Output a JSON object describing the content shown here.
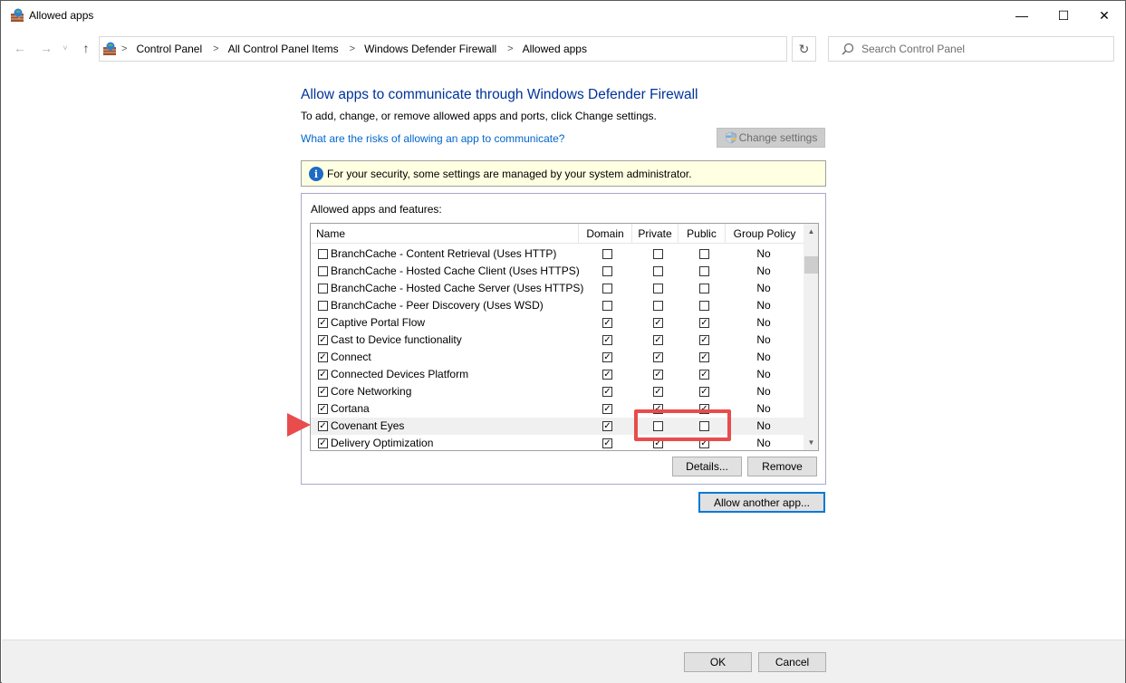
{
  "window": {
    "title": "Allowed apps",
    "minimize_glyph": "—",
    "maximize_glyph": "☐",
    "close_glyph": "✕"
  },
  "nav": {
    "back_glyph": "←",
    "forward_glyph": "→",
    "recent_glyph": "˅",
    "up_glyph": "↑",
    "breadcrumbs": [
      "Control Panel",
      "All Control Panel Items",
      "Windows Defender Firewall",
      "Allowed apps"
    ],
    "separator": ">",
    "dropdown_glyph": "⌄",
    "refresh_glyph": "↻",
    "search_placeholder": "Search Control Panel"
  },
  "main": {
    "heading": "Allow apps to communicate through Windows Defender Firewall",
    "subtext": "To add, change, or remove allowed apps and ports, click Change settings.",
    "risk_link": "What are the risks of allowing an app to communicate?",
    "change_settings": "Change settings",
    "info_icon": "i",
    "info_text": "For your security, some settings are managed by your system administrator.",
    "group_label": "Allowed apps and features:",
    "columns": [
      "Name",
      "Domain",
      "Private",
      "Public",
      "Group Policy"
    ],
    "rows": [
      {
        "name": "BranchCache - Content Retrieval (Uses HTTP)",
        "enabled": "",
        "domain": "",
        "private": "",
        "public": "",
        "gp": "No"
      },
      {
        "name": "BranchCache - Hosted Cache Client (Uses HTTPS)",
        "enabled": "",
        "domain": "",
        "private": "",
        "public": "",
        "gp": "No"
      },
      {
        "name": "BranchCache - Hosted Cache Server (Uses HTTPS)",
        "enabled": "",
        "domain": "",
        "private": "",
        "public": "",
        "gp": "No"
      },
      {
        "name": "BranchCache - Peer Discovery (Uses WSD)",
        "enabled": "",
        "domain": "",
        "private": "",
        "public": "",
        "gp": "No"
      },
      {
        "name": "Captive Portal Flow",
        "enabled": "✓",
        "domain": "✓",
        "private": "✓",
        "public": "✓",
        "gp": "No"
      },
      {
        "name": "Cast to Device functionality",
        "enabled": "✓",
        "domain": "✓",
        "private": "✓",
        "public": "✓",
        "gp": "No"
      },
      {
        "name": "Connect",
        "enabled": "✓",
        "domain": "✓",
        "private": "✓",
        "public": "✓",
        "gp": "No"
      },
      {
        "name": "Connected Devices Platform",
        "enabled": "✓",
        "domain": "✓",
        "private": "✓",
        "public": "✓",
        "gp": "No"
      },
      {
        "name": "Core Networking",
        "enabled": "✓",
        "domain": "✓",
        "private": "✓",
        "public": "✓",
        "gp": "No"
      },
      {
        "name": "Cortana",
        "enabled": "✓",
        "domain": "✓",
        "private": "✓",
        "public": "✓",
        "gp": "No"
      },
      {
        "name": "Covenant Eyes",
        "enabled": "✓",
        "domain": "✓",
        "private": "",
        "public": "",
        "gp": "No"
      },
      {
        "name": "Delivery Optimization",
        "enabled": "✓",
        "domain": "✓",
        "private": "✓",
        "public": "✓",
        "gp": "No"
      }
    ],
    "scroll_up_glyph": "▲",
    "scroll_down_glyph": "▼",
    "details_button": "Details...",
    "remove_button": "Remove",
    "allow_another_button": "Allow another app..."
  },
  "footer": {
    "ok_button": "OK",
    "cancel_button": "Cancel"
  },
  "colors": {
    "heading": "#003399",
    "link": "#0066cc",
    "annotation": "#e84c4c",
    "info_bar": "#ffffe1"
  }
}
